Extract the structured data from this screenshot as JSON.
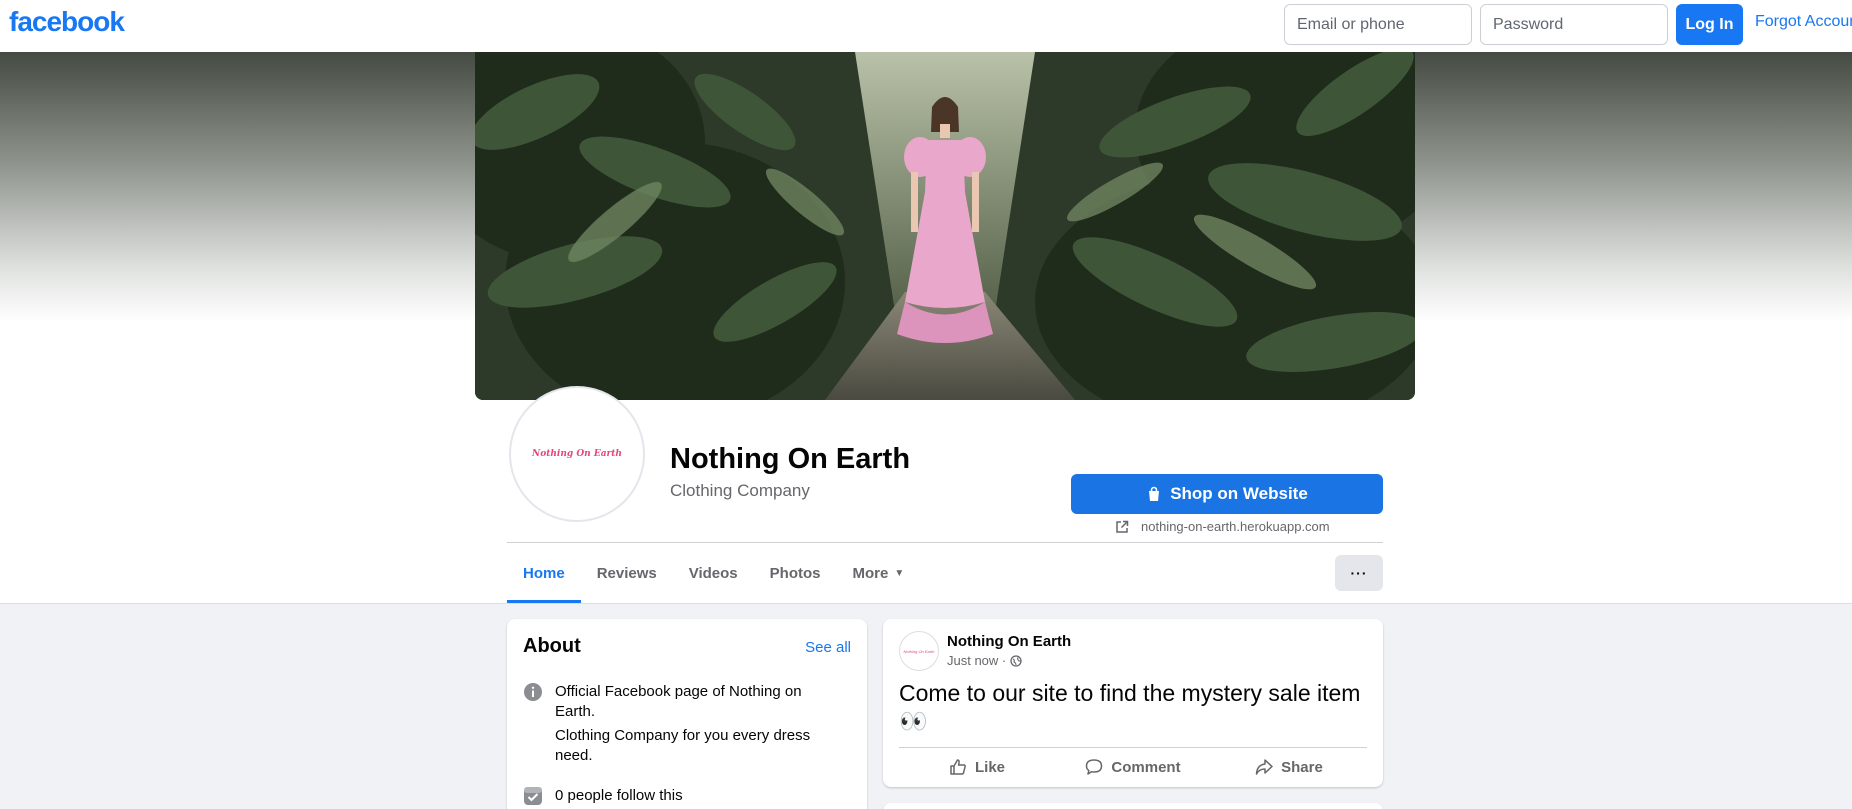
{
  "topbar": {
    "logo": "facebook",
    "email_placeholder": "Email or phone",
    "password_placeholder": "Password",
    "login_label": "Log In",
    "forgot_label": "Forgot Account?"
  },
  "page": {
    "name": "Nothing On Earth",
    "category": "Clothing Company",
    "avatar_text": "Nothing On Earth",
    "shop_button": "Shop on Website",
    "website": "nothing-on-earth.herokuapp.com"
  },
  "tabs": [
    {
      "label": "Home",
      "active": true
    },
    {
      "label": "Reviews"
    },
    {
      "label": "Videos"
    },
    {
      "label": "Photos"
    },
    {
      "label": "More"
    }
  ],
  "more_button": "···",
  "about": {
    "title": "About",
    "see_all": "See all",
    "description": "Official Facebook page of Nothing on Earth.",
    "description2": "Clothing Company for you every dress need.",
    "followers": "0 people follow this"
  },
  "post": {
    "author": "Nothing On Earth",
    "time": "Just now ·",
    "text": "Come to our site to find the mystery sale item 👀",
    "actions": {
      "like": "Like",
      "comment": "Comment",
      "share": "Share"
    }
  },
  "colors": {
    "brand": "#1877f2",
    "page_bg": "#f0f2f5",
    "avatar_accent": "#e7457d",
    "dress": "#e9a7cc"
  }
}
